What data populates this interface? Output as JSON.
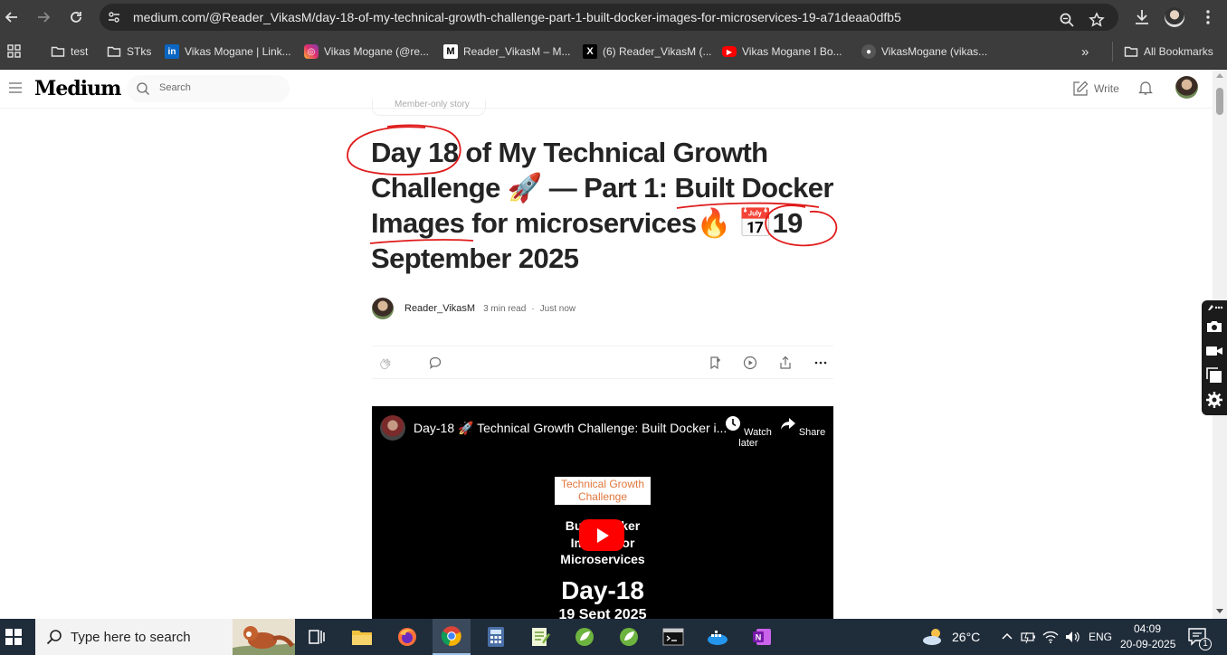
{
  "browser": {
    "url": "medium.com/@Reader_VikasM/day-18-of-my-technical-growth-challenge-part-1-built-docker-images-for-microservices-19-a71deaa0dfb5",
    "bookmarks": [
      {
        "label": "test",
        "icon": "folder-icon"
      },
      {
        "label": "STks",
        "icon": "folder-icon"
      },
      {
        "label": "Vikas Mogane | Link...",
        "icon": "linkedin-icon"
      },
      {
        "label": "Vikas Mogane (@re...",
        "icon": "instagram-icon"
      },
      {
        "label": "Reader_VikasM – M...",
        "icon": "medium-icon"
      },
      {
        "label": "(6) Reader_VikasM (...",
        "icon": "x-icon"
      },
      {
        "label": "Vikas Mogane I Bo...",
        "icon": "youtube-icon"
      },
      {
        "label": "VikasMogane (vikas...",
        "icon": "github-icon"
      }
    ],
    "all_bookmarks": "All Bookmarks",
    "overflow": "»"
  },
  "medium": {
    "logo": "Medium",
    "search_placeholder": "Search",
    "write": "Write"
  },
  "article": {
    "member_label": "Member-only story",
    "title_line1": "Day 18 of My Technical Growth",
    "title_line2": "Challenge 🚀 — Part 1: Built Docker",
    "title_line3": "Images for microservices🔥 📅19",
    "title_line4": "September 2025",
    "author": "Reader_VikasM",
    "read_time": "3 min read",
    "separator": "·",
    "published": "Just now"
  },
  "video": {
    "title": "Day-18 🚀 Technical Growth Challenge: Built Docker i...",
    "watch_later": "Watch later",
    "share": "Share",
    "thumb_box_line1": "Technical Growth",
    "thumb_box_line2": "Challenge",
    "thumb_line1": "Built Docker",
    "thumb_line2": "Images for",
    "thumb_line3": "Microservices",
    "thumb_day": "Day-18",
    "thumb_date": "19 Sept 2025"
  },
  "taskbar": {
    "search_placeholder": "Type here to search",
    "weather": "26°C",
    "language": "ENG",
    "time": "04:09",
    "date": "20-09-2025",
    "notification_count": "1"
  },
  "colors": {
    "chrome_bg": "#3c3c3c",
    "omnibox_bg": "#282828",
    "annotation_red": "#e01b1b",
    "taskbar_bg": "#1f2c3a",
    "youtube_red": "#ff0000"
  }
}
